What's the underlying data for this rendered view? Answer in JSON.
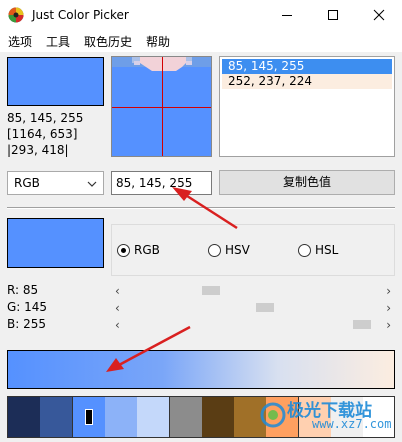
{
  "window": {
    "title": "Just Color Picker"
  },
  "menu": [
    "选项",
    "工具",
    "取色历史",
    "帮助"
  ],
  "colors": {
    "current": "#5591ff",
    "history_selected_bg": "#3d8ef0",
    "history_second_bg": "#fcede0",
    "annotation_red": "#d92020"
  },
  "readout": {
    "rgb": "85, 145, 255",
    "screen_pos": "[1164, 653]",
    "window_pos": "|293, 418|"
  },
  "history": [
    {
      "label": "85, 145, 255",
      "selected": true
    },
    {
      "label": "252, 237, 224",
      "selected": false
    }
  ],
  "format": {
    "selected": "RGB"
  },
  "color_value": "85, 145, 255",
  "copy_button": "复制色值",
  "modes": [
    {
      "label": "RGB",
      "checked": true
    },
    {
      "label": "HSV",
      "checked": false
    },
    {
      "label": "HSL",
      "checked": false
    }
  ],
  "channels": [
    {
      "label": "R: 85",
      "value": 85,
      "max": 255
    },
    {
      "label": "G: 145",
      "value": 145,
      "max": 255
    },
    {
      "label": "B: 255",
      "value": 255,
      "max": 255
    }
  ],
  "palette": [
    "#1c2d57",
    "#37589a",
    "#5591ff",
    "#8cb2f8",
    "#c4d8fa",
    "#8c8c8c",
    "#5a3d14",
    "#a07028",
    "#ffa060",
    "#ffd0b0",
    "#f0f0f0",
    "#ffffff"
  ],
  "icons": {
    "app": "color-picker-logo-icon",
    "minimize": "minimize-icon",
    "maximize": "maximize-icon",
    "close": "close-icon",
    "dropdown": "chevron-down-icon",
    "scroll_left": "chevron-left-icon",
    "scroll_right": "chevron-right-icon"
  },
  "watermark": {
    "text": "极光下载站",
    "url": "www.xz7.com"
  }
}
